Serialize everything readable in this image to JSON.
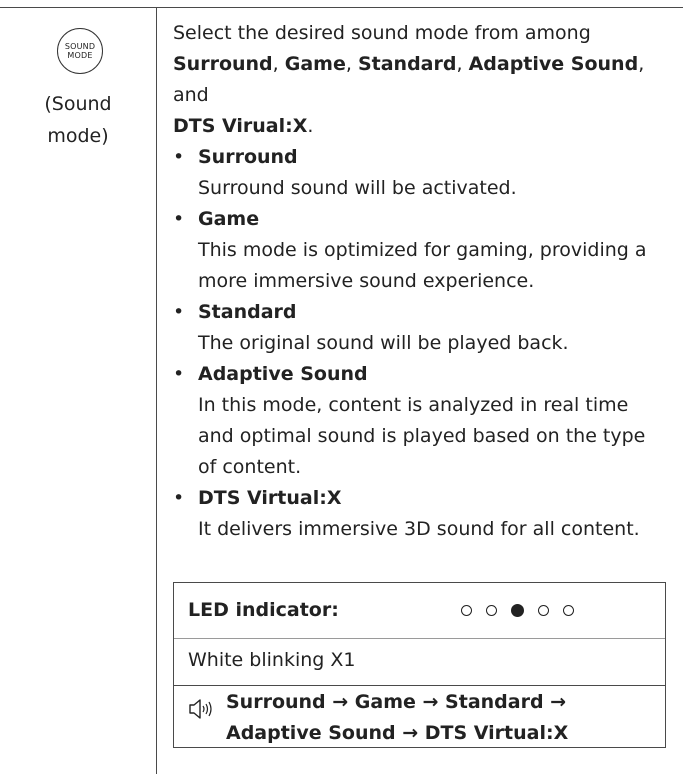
{
  "left": {
    "button_text": [
      "SOUND",
      "MODE"
    ],
    "caption": [
      "(Sound",
      "mode)"
    ]
  },
  "intro": {
    "line1": "Select the desired sound mode from among",
    "opt1": "Surround",
    "opt2": "Game",
    "opt3": "Standard",
    "opt4": "Adaptive Sound",
    "and_text": ", and",
    "opt5": "DTS Virual:X",
    "end": "."
  },
  "modes": [
    {
      "bullet": "•",
      "title": "Surround",
      "desc": "Surround sound will be activated."
    },
    {
      "bullet": "•",
      "title": "Game",
      "desc": "This mode is optimized for gaming, providing a more immersive sound experience."
    },
    {
      "bullet": "•",
      "title": "Standard",
      "desc": "The original sound will be played back."
    },
    {
      "bullet": "•",
      "title": "Adaptive Sound",
      "desc": "In this mode, content is analyzed in real time and optimal sound is played based on the type of content."
    },
    {
      "bullet": "•",
      "title": "DTS Virtual:X",
      "desc": "It delivers immersive 3D sound for all content."
    }
  ],
  "indicator": {
    "label": "LED indicator:",
    "leds": [
      false,
      false,
      true,
      false,
      false
    ],
    "status": "White blinking X1",
    "sequence": "Surround → Game → Standard → Adaptive Sound → DTS Virtual:X",
    "icon": "speaker-icon"
  }
}
